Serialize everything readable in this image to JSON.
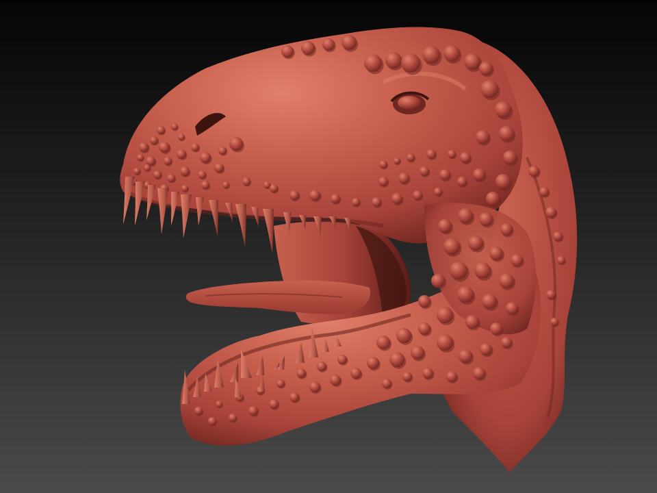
{
  "scene": {
    "subject": "sculpted-trex-head",
    "colors": {
      "background_top": "#050505",
      "background_mid": "#2a2a2a",
      "background_bottom": "#4a4a4a",
      "clay_base": "#a8433a",
      "clay_light": "#c9614f",
      "clay_highlight": "#e0806a",
      "clay_shadow": "#6e2620",
      "clay_deep": "#3e1410",
      "mouth_inner": "#5a1c17",
      "tongue": "#9a3a31",
      "tooth": "#b65a4a",
      "tooth_tip": "#7a2e26"
    }
  }
}
